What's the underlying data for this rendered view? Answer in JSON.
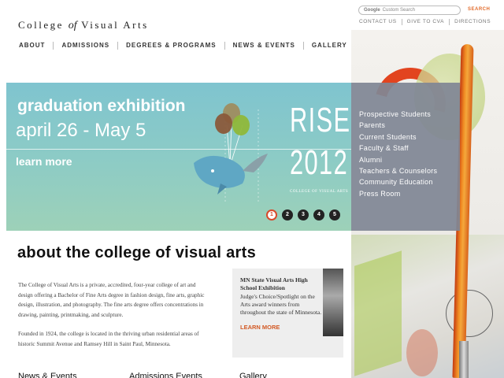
{
  "brand": {
    "logo_pre": "College",
    "logo_of": "of",
    "logo_post": "Visual Arts"
  },
  "utility": {
    "search_provider": "Google",
    "search_placeholder": "Custom Search",
    "search_button": "SEARCH",
    "links": [
      "CONTACT US",
      "GIVE TO CVA",
      "DIRECTIONS"
    ]
  },
  "main_nav": [
    "ABOUT",
    "ADMISSIONS",
    "DEGREES & PROGRAMS",
    "NEWS & EVENTS",
    "GALLERY"
  ],
  "hero": {
    "title": "graduation exhibition",
    "dates": "april 26 - May 5",
    "learn_more": "learn more",
    "rise": "RISE",
    "year": "2012",
    "rise_sub": "COLLEGE OF VISUAL ARTS",
    "slides": [
      "1",
      "2",
      "3",
      "4",
      "5"
    ],
    "active_slide": 1
  },
  "audience_links": [
    "Prospective Students",
    "Parents",
    "Current Students",
    "Faculty & Staff",
    "Alumni",
    "Teachers & Counselors",
    "Community Education",
    "Press Room"
  ],
  "about": {
    "heading": "about the college of visual arts",
    "p1": "The College of Visual Arts is a private, accredited, four-year college of art and design offering a Bachelor of Fine Arts degree in fashion design, fine arts, graphic design, illustration, and photography. The fine arts degree offers concentrations in drawing, painting, printmaking, and sculpture.",
    "p2": "Founded in 1924, the college is located in the thriving urban residential areas of historic Summit Avenue and Ramsey Hill in Saint Paul, Minnesota."
  },
  "feature": {
    "title": "MN State Visual Arts High School Exhibition",
    "body": "Judge's Choice/Spotlight on the Arts award winners from throughout the state of Minnesota.",
    "link": "LEARN MORE"
  },
  "sections": [
    "News & Events",
    "Admissions Events",
    "Gallery"
  ],
  "colors": {
    "hero_bg": "#8ccbc6",
    "audience_bg": "#808694",
    "accent": "#d35a25"
  }
}
